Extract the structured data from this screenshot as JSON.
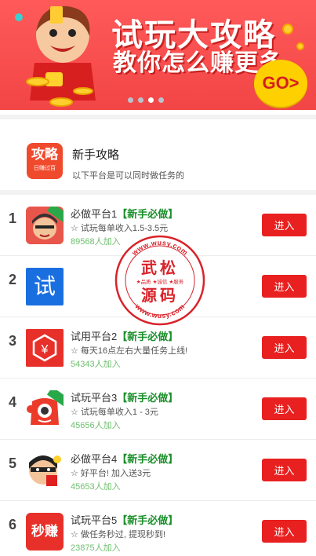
{
  "banner": {
    "title": "试玩大攻略",
    "subtitle": "教你怎么赚更多",
    "go_label": "GO>",
    "carousel_dots": 4,
    "active_dot": 2
  },
  "guide": {
    "logo_big": "攻略",
    "logo_small": "日赚过百",
    "title": "新手攻略",
    "description": "以下平台是可以同时做任务的"
  },
  "watermark": {
    "name_top": "武松",
    "name_bottom": "源码",
    "ring_top": "www.wusy.com",
    "ring_bottom": "www.wusy.com",
    "motto": "★品质 ★诚信 ★服务"
  },
  "platforms": [
    {
      "rank": "1",
      "name": "必做平台1",
      "tag": "【新手必做】",
      "desc": "☆ 试玩每单收入1.5-3.5元",
      "count": "89568人加入",
      "button": "进入",
      "icon": "cartoon-face-icon"
    },
    {
      "rank": "2",
      "name": "",
      "tag": "",
      "desc": "",
      "count": "",
      "button": "进入",
      "icon": "shi-char-icon",
      "icon_text": "试"
    },
    {
      "rank": "3",
      "name": "试用平台2",
      "tag": "【新手必做】",
      "desc": "☆ 每天16点左右大量任务上线!",
      "count": "54343人加入",
      "button": "进入",
      "icon": "yen-shield-icon",
      "icon_text": "¥"
    },
    {
      "rank": "4",
      "name": "试玩平台3",
      "tag": "【新手必做】",
      "desc": "☆ 试玩每单收入1 - 3元",
      "count": "45656人加入",
      "button": "进入",
      "icon": "bag-mascot-icon"
    },
    {
      "rank": "5",
      "name": "必做平台4",
      "tag": "【新手必做】",
      "desc": "☆ 好平台! 加入送3元",
      "count": "45653人加入",
      "button": "进入",
      "icon": "ninja-mascot-icon"
    },
    {
      "rank": "6",
      "name": "试玩平台5",
      "tag": "【新手必做】",
      "desc": "☆ 做任务秒过, 提现秒到!",
      "count": "23875人加入",
      "button": "进入",
      "icon": "miaozhuan-icon",
      "icon_text": "秒赚"
    }
  ],
  "colors": {
    "banner_red": "#f24545",
    "enter_button": "#e8201f",
    "tag_green": "#1a8f2a",
    "count_green": "#6fbf6f",
    "go_yellow": "#ffd000"
  }
}
